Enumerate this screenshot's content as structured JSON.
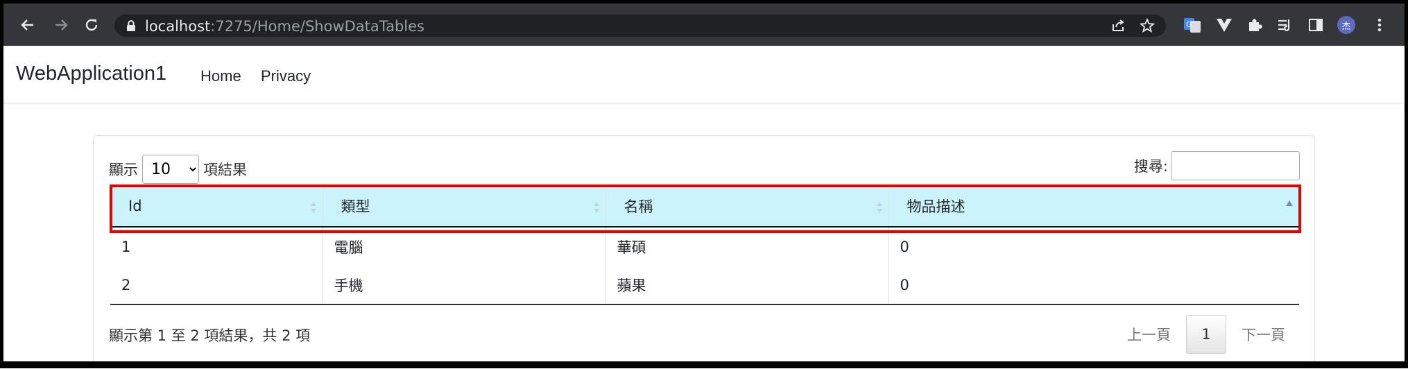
{
  "browser": {
    "url_host": "localhost",
    "url_rest": ":7275/Home/ShowDataTables",
    "profile_initial": "杰"
  },
  "navbar": {
    "brand": "WebApplication1",
    "links": [
      "Home",
      "Privacy"
    ]
  },
  "datatable": {
    "length_prefix": "顯示",
    "length_value": "10",
    "length_suffix": "項結果",
    "search_label": "搜尋:",
    "search_value": "",
    "columns": [
      "Id",
      "類型",
      "名稱",
      "物品描述"
    ],
    "rows": [
      [
        "1",
        "電腦",
        "華碩",
        "0"
      ],
      [
        "2",
        "手機",
        "蘋果",
        "0"
      ]
    ],
    "info": "顯示第 1 至 2 項結果，共 2 項",
    "pager": {
      "prev": "上一頁",
      "current": "1",
      "next": "下一頁"
    }
  },
  "colors": {
    "header_bg": "#cbf3fb",
    "highlight": "#e60000",
    "toolbar": "#35363a"
  }
}
